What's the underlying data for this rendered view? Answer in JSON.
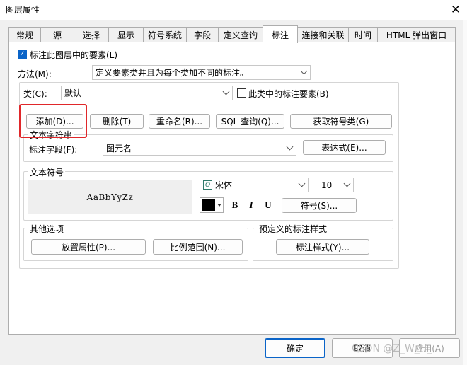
{
  "window": {
    "title": "图层属性",
    "close_glyph": "✕"
  },
  "tabs": [
    {
      "label": "常规"
    },
    {
      "label": "源"
    },
    {
      "label": "选择"
    },
    {
      "label": "显示"
    },
    {
      "label": "符号系统"
    },
    {
      "label": "字段"
    },
    {
      "label": "定义查询"
    },
    {
      "label": "标注"
    },
    {
      "label": "连接和关联"
    },
    {
      "label": "时间"
    },
    {
      "label": "HTML 弹出窗口"
    }
  ],
  "active_tab": "标注",
  "label_layer_checkbox": {
    "label": "标注此图层中的要素(L)",
    "checked": true
  },
  "method": {
    "label": "方法(M):",
    "value": "定义要素类并且为每个类加不同的标注。"
  },
  "class": {
    "label": "类(C):",
    "value": "默认",
    "only_features_checkbox": {
      "label": "此类中的标注要素(B)",
      "checked": false
    }
  },
  "class_buttons": {
    "add": "添加(D)...",
    "delete": "删除(T)",
    "rename": "重命名(R)...",
    "sql": "SQL 查询(Q)...",
    "get_symbols": "获取符号类(G)"
  },
  "text_string": {
    "group_label": "文本字符串",
    "field_label": "标注字段(F):",
    "field_value": "图元名",
    "expression_button": "表达式(E)..."
  },
  "text_symbol": {
    "group_label": "文本符号",
    "preview_text": "AaBbYyZz",
    "font_icon_glyph": "O",
    "font": "宋体",
    "size": "10",
    "color": "#000000",
    "bold": "B",
    "italic": "I",
    "underline": "U",
    "symbol_button": "符号(S)..."
  },
  "other_options": {
    "group_label": "其他选项",
    "placement_button": "放置属性(P)...",
    "scale_button": "比例范围(N)..."
  },
  "predefined_styles": {
    "group_label": "预定义的标注样式",
    "styles_button": "标注样式(Y)..."
  },
  "footer": {
    "ok": "确定",
    "cancel": "取消",
    "apply": "应用(A)"
  },
  "watermark": "CSDN @Z_W_H_"
}
